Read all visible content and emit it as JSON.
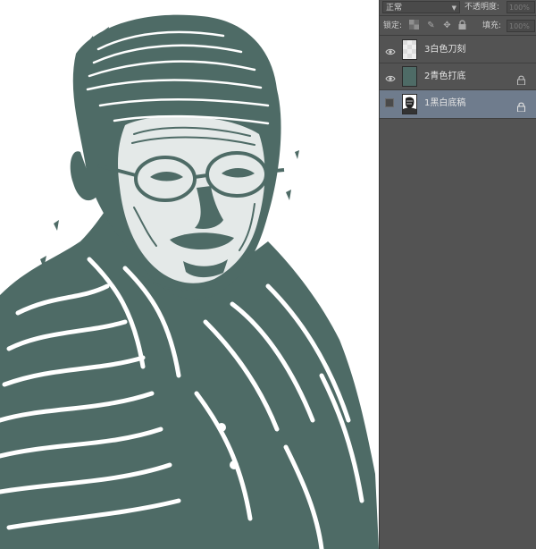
{
  "layers_panel": {
    "blend_mode": "正常",
    "opacity_label": "不透明度:",
    "opacity_value": "100%",
    "lock_label": "锁定:",
    "fill_label": "填充:",
    "fill_value": "100%",
    "layers": [
      {
        "name": "3白色刀刻",
        "visible": true,
        "locked": false,
        "selected": false,
        "thumb": "white"
      },
      {
        "name": "2青色打底",
        "visible": true,
        "locked": true,
        "selected": false,
        "thumb": "teal"
      },
      {
        "name": "1黑白底稿",
        "visible": false,
        "locked": true,
        "selected": true,
        "thumb": "sketch"
      }
    ]
  },
  "colors": {
    "ink": "#4e6b66",
    "panel_bg": "#535353",
    "selected_row": "#6f7c8d"
  },
  "icons": [
    "eye-icon",
    "lock-icon",
    "transparency-lock-icon",
    "brush-lock-icon",
    "move-lock-icon",
    "all-lock-icon"
  ]
}
